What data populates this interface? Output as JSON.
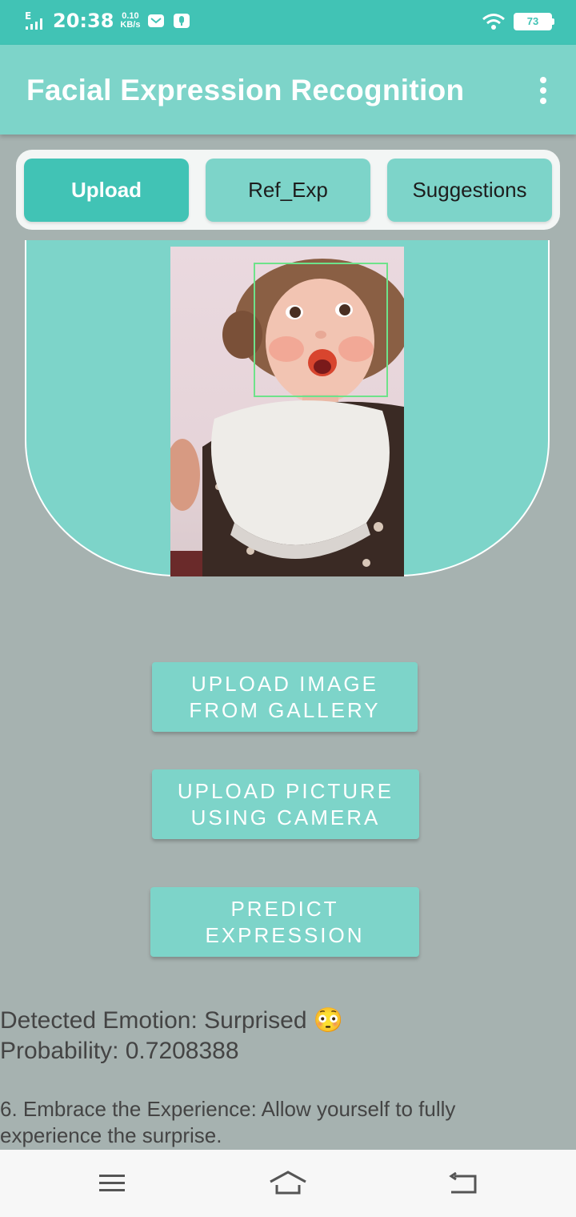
{
  "status_bar": {
    "network": "E",
    "time": "20:38",
    "speed_value": "0.10",
    "speed_unit": "KB/s",
    "battery": "73"
  },
  "app_bar": {
    "title": "Facial Expression Recognition",
    "menu_icon": "more-vert-icon"
  },
  "tabs": [
    {
      "label": "Upload",
      "active": true
    },
    {
      "label": "Ref_Exp",
      "active": false
    },
    {
      "label": "Suggestions",
      "active": false
    }
  ],
  "buttons": {
    "gallery_line1": "UPLOAD IMAGE",
    "gallery_line2": "FROM GALLERY",
    "camera_line1": "UPLOAD PICTURE",
    "camera_line2": "USING CAMERA",
    "predict_line1": "PREDICT",
    "predict_line2": "EXPRESSION"
  },
  "result": {
    "emotion_line": "Detected Emotion: Surprised",
    "emoji": "😳",
    "probability_line": "Probability: 0.7208388"
  },
  "suggestion": {
    "text": "6. Embrace the Experience: Allow yourself to fully experience the surprise."
  },
  "nav_bar": {
    "icons": [
      "menu-icon",
      "home-icon",
      "back-icon"
    ]
  },
  "colors": {
    "primary": "#41c3b5",
    "accent": "#7dd4c9",
    "background": "#a6b2b0",
    "face_box": "#6ee28a"
  }
}
